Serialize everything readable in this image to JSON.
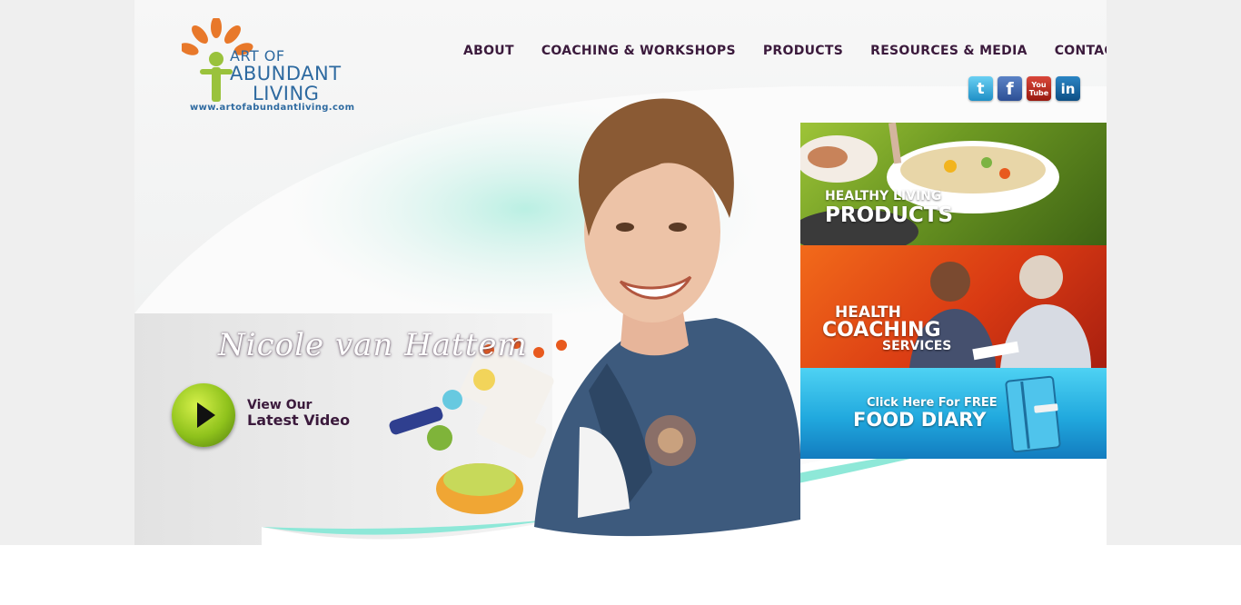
{
  "logo": {
    "line1": "ART OF",
    "line2": "ABUNDANT",
    "line3": "LIVING",
    "url": "www.artofabundantliving.com"
  },
  "nav": {
    "items": [
      {
        "label": "ABOUT"
      },
      {
        "label": "COACHING & WORKSHOPS"
      },
      {
        "label": "PRODUCTS"
      },
      {
        "label": "RESOURCES & MEDIA"
      },
      {
        "label": "CONTACT"
      }
    ]
  },
  "social": {
    "twitter": "t",
    "facebook": "f",
    "youtube_top": "You",
    "youtube_bottom": "Tube",
    "linkedin": "in"
  },
  "hero": {
    "signature": "Nicole van Hattem",
    "video_line1": "View Our",
    "video_line2": "Latest Video"
  },
  "panels": {
    "products": {
      "line1": "HEALTHY LIVING",
      "line2": "PRODUCTS"
    },
    "coaching": {
      "line1": "HEALTH",
      "line2": "COACHING",
      "line3": "SERVICES"
    },
    "diary": {
      "line1": "Click Here For FREE",
      "line2": "FOOD DIARY"
    }
  },
  "colors": {
    "nav_text": "#3b1a3c",
    "logo_blue": "#2e6aa0",
    "logo_orange": "#e8782a",
    "logo_green": "#9ac23c",
    "teal_wave": "#8ee8d8"
  }
}
